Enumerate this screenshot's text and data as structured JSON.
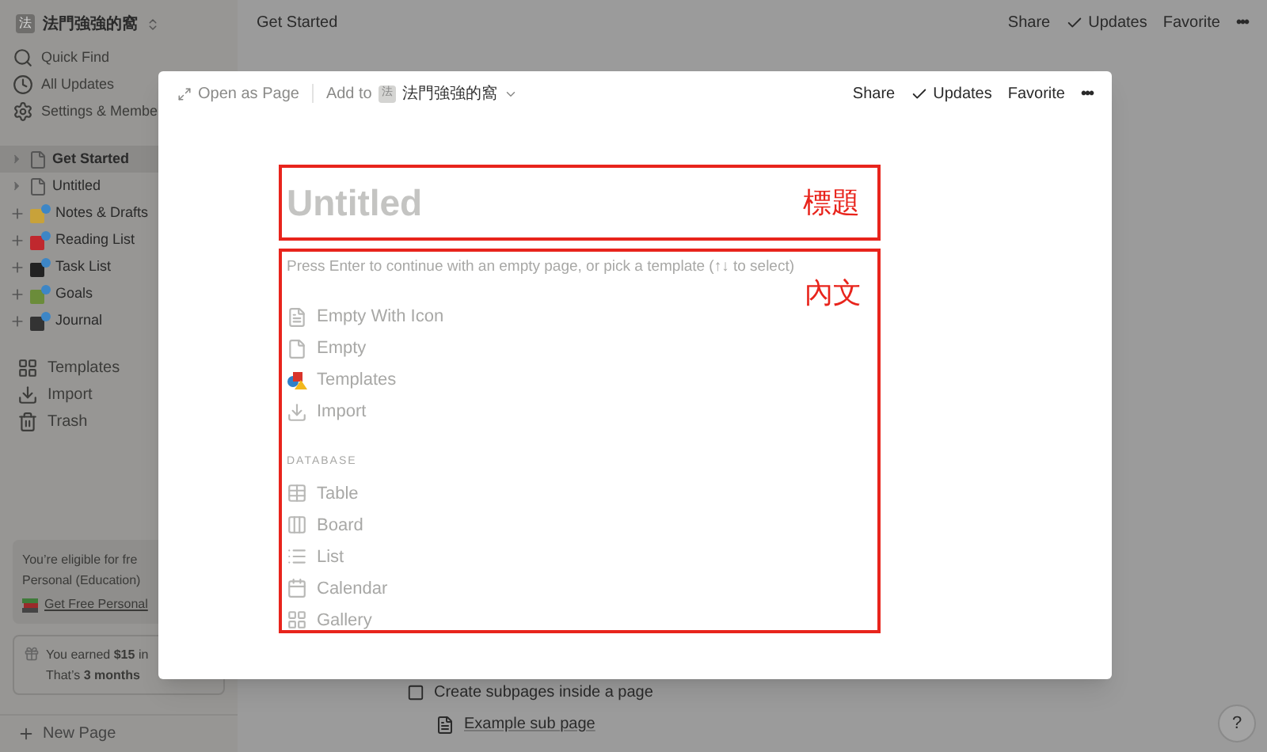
{
  "sidebar": {
    "workspace": {
      "badge": "法",
      "name": "法門強強的窩"
    },
    "top_items": [
      {
        "label": "Quick Find",
        "kind": "search"
      },
      {
        "label": "All Updates",
        "kind": "clock"
      },
      {
        "label": "Settings & Membe",
        "kind": "gear"
      }
    ],
    "pages": [
      {
        "label": "Get Started",
        "kind": "page",
        "selected": true
      },
      {
        "label": "Untitled",
        "kind": "page",
        "selected": false
      },
      {
        "label": "Notes & Drafts",
        "kind": "emoji",
        "color": "#c8a23a",
        "selected": false
      },
      {
        "label": "Reading List",
        "kind": "emoji",
        "color": "#c0282e",
        "selected": false
      },
      {
        "label": "Task List",
        "kind": "emoji",
        "color": "#222222",
        "selected": false
      },
      {
        "label": "Goals",
        "kind": "emoji",
        "color": "#6b8c3a",
        "selected": false
      },
      {
        "label": "Journal",
        "kind": "emoji",
        "color": "#333333",
        "selected": false
      }
    ],
    "bottom_items": [
      {
        "label": "Templates",
        "kind": "templates"
      },
      {
        "label": "Import",
        "kind": "import"
      },
      {
        "label": "Trash",
        "kind": "trash"
      }
    ],
    "promo": {
      "line_1": "You’re eligible for fre",
      "line_2": "Personal (Education)",
      "link": "Get Free Personal"
    },
    "credit": {
      "line_1": "You earned **$15** in",
      "line_2": "That’s **3 months**"
    },
    "new_page": "New Page"
  },
  "main": {
    "title": "Get Started",
    "actions": [
      "Share",
      "Updates",
      "Favorite"
    ],
    "more": "•••",
    "todo": {
      "label": "Create subpages inside a page",
      "checked": false
    },
    "sub_page": "Example sub page",
    "help": "?"
  },
  "modal": {
    "open_as_page": "Open as Page",
    "add_to": "Add to",
    "workspace_badge": "法",
    "workspace": "法門強強的窩",
    "actions": [
      "Share",
      "Updates",
      "Favorite"
    ],
    "more": "•••",
    "title_placeholder": "Untitled",
    "title_annotation": "標題",
    "hint": "Press Enter to continue with an empty page, or pick a template (↑↓ to select)",
    "body_annotation": "內文",
    "items": [
      {
        "label": "Empty With Icon",
        "kind": "page-lines"
      },
      {
        "label": "Empty",
        "kind": "page"
      },
      {
        "label": "Templates",
        "kind": "templates"
      },
      {
        "label": "Import",
        "kind": "import"
      }
    ],
    "section": "DATABASE",
    "database_items": [
      {
        "label": "Table",
        "kind": "table"
      },
      {
        "label": "Board",
        "kind": "board"
      },
      {
        "label": "List",
        "kind": "list"
      },
      {
        "label": "Calendar",
        "kind": "calendar"
      },
      {
        "label": "Gallery",
        "kind": "gallery"
      }
    ]
  }
}
